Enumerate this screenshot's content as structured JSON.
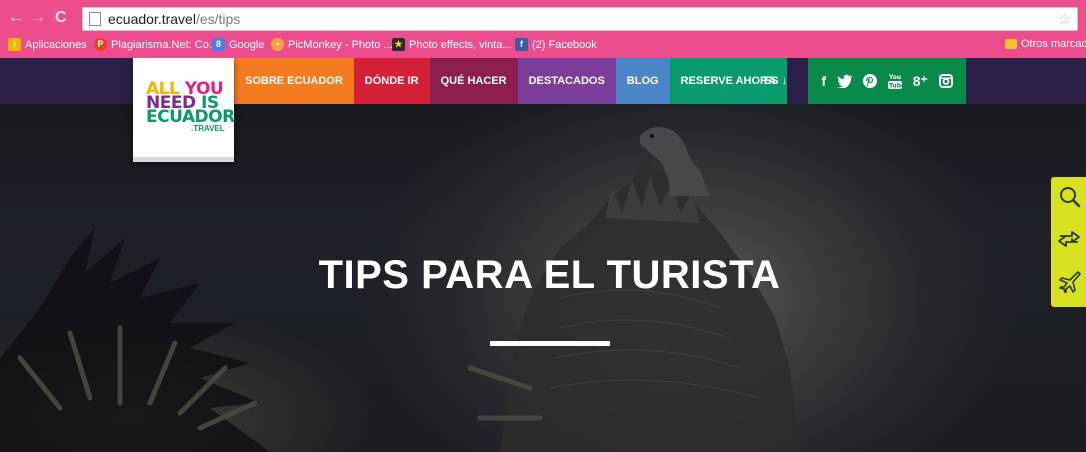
{
  "browser": {
    "url_host": "ecuador.travel",
    "url_path": "/es/tips",
    "bookmarks": [
      {
        "label": "Aplicaciones",
        "icon": "apps-icon"
      },
      {
        "label": "Plagiarisma.Net: Co...",
        "icon": "plagiarisma-icon"
      },
      {
        "label": "Google",
        "icon": "google-icon"
      },
      {
        "label": "PicMonkey - Photo ...",
        "icon": "picmonkey-icon"
      },
      {
        "label": "Photo effects, vinta...",
        "icon": "photo-effects-icon"
      },
      {
        "label": "(2) Facebook",
        "icon": "facebook-icon"
      }
    ],
    "other_bookmarks": "Otros marcado"
  },
  "site": {
    "logo": {
      "line1a": "ALL",
      "line1b": "YOU",
      "line2a": "NEED",
      "line2b": "IS",
      "line3": "ECUADOR",
      "sub": ".TRAVEL"
    },
    "menu": [
      {
        "label": "SOBRE ECUADOR",
        "color": "#f47b20"
      },
      {
        "label": "DÓNDE IR",
        "color": "#d5203a"
      },
      {
        "label": "QUÉ HACER",
        "color": "#8c1e50"
      },
      {
        "label": "DESTACADOS",
        "color": "#7c3d9b"
      },
      {
        "label": "BLOG",
        "color": "#4a86c8"
      },
      {
        "label": "RESERVE AHORA",
        "color": "#0a9b6c"
      }
    ],
    "lang": "ES",
    "social": [
      "facebook-icon",
      "twitter-icon",
      "pinterest-icon",
      "youtube-icon",
      "googleplus-icon",
      "instagram-icon"
    ],
    "hero_title": "TIPS PARA EL TURISTA",
    "side_tools": [
      "search-icon",
      "exchange-arrows-icon",
      "airplane-icon"
    ],
    "colors": {
      "browser_frame": "#ec4d8c",
      "topbar": "#2c1f48",
      "social_bar": "#0a8a4a",
      "side_tools": "#d8e022"
    }
  }
}
